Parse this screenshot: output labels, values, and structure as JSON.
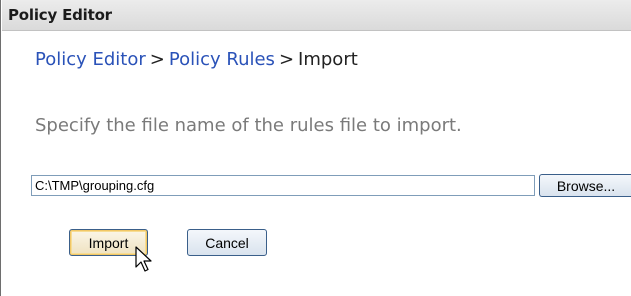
{
  "window": {
    "title": "Policy Editor"
  },
  "breadcrumb": {
    "items": [
      {
        "label": "Policy Editor"
      },
      {
        "label": "Policy Rules"
      }
    ],
    "separator": ">",
    "current": "Import"
  },
  "instructions": "Specify the file name of the rules file to import.",
  "file_input": {
    "value": "C:\\TMP\\grouping.cfg"
  },
  "buttons": {
    "browse": "Browse...",
    "import": "Import",
    "cancel": "Cancel"
  },
  "cursor": {
    "icon": "mouse-pointer-icon"
  }
}
